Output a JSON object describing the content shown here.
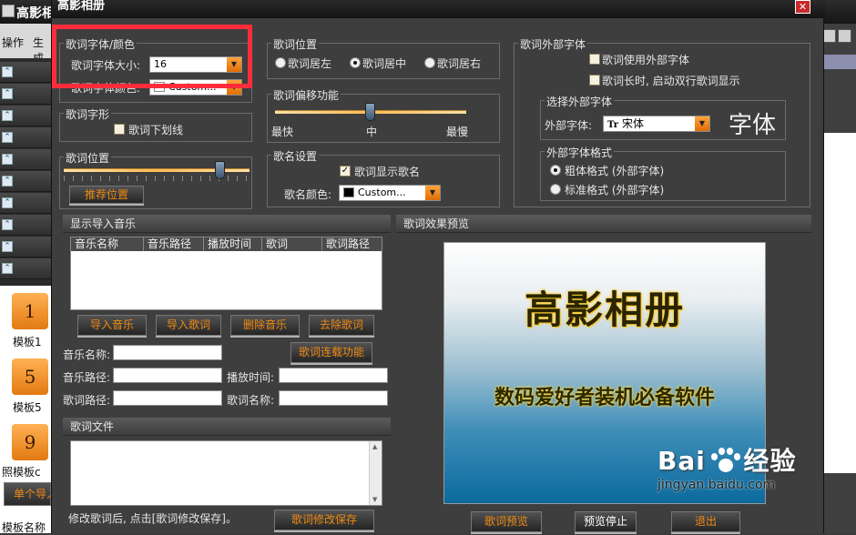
{
  "background_app": {
    "title": "高影相",
    "menu": [
      "操作",
      "生成"
    ],
    "templates": [
      {
        "num": "1",
        "label": "模板1"
      },
      {
        "num": "5",
        "label": "模板5"
      },
      {
        "num": "9",
        "label": "照模板c"
      }
    ],
    "single_button": "单个导入",
    "template_name_label": "模板名称"
  },
  "dialog": {
    "title": "高影相册",
    "lyric_font": {
      "group_title": "歌词字体/颜色",
      "size_label": "歌词字体大小:",
      "size_value": "16",
      "color_label": "歌词字体颜色:",
      "color_value": "Custom..."
    },
    "lyric_style": {
      "group_title": "歌词字形",
      "underline": "歌词下划线"
    },
    "lyric_pos_left": {
      "group_title": "歌词位置",
      "recommend_button": "推荐位置"
    },
    "lyric_pos": {
      "group_title": "歌词位置",
      "options": [
        "歌词居左",
        "歌词居中",
        "歌词居右"
      ],
      "selected": "歌词居中"
    },
    "offset": {
      "group_title": "歌词偏移功能",
      "labels": [
        "最快",
        "中",
        "最慢"
      ]
    },
    "song_name": {
      "group_title": "歌名设置",
      "show_checkbox": "歌词显示歌名",
      "color_label": "歌名颜色:",
      "color_value": "Custom..."
    },
    "external_font": {
      "group_title": "歌词外部字体",
      "use_external": "歌词使用外部字体",
      "double_line": "歌词长时, 启动双行歌词显示",
      "select_group": "选择外部字体",
      "font_label": "外部字体:",
      "font_value": "宋体",
      "font_sample": "字体",
      "format_group": "外部字体格式",
      "format_options": [
        "粗体格式 (外部字体)",
        "标准格式 (外部字体)"
      ],
      "format_selected": "粗体格式 (外部字体)"
    },
    "import_music": {
      "title": "显示导入音乐",
      "columns": [
        "音乐名称",
        "音乐路径",
        "播放时间",
        "歌词",
        "歌词路径"
      ],
      "buttons": [
        "导入音乐",
        "导入歌词",
        "删除音乐",
        "去除歌词"
      ],
      "music_name_label": "音乐名称:",
      "lyric_load_button": "歌词连载功能",
      "music_path_label": "音乐路径:",
      "play_time_label": "播放时间:",
      "lyric_path_label": "歌词路径:",
      "lyric_name_label": "歌词名称:"
    },
    "lyric_file": {
      "title": "歌词文件",
      "note": "修改歌词后, 点击[歌词修改保存]。",
      "save_button": "歌词修改保存"
    },
    "preview": {
      "title": "歌词效果预览",
      "main_text": "高影相册",
      "sub_text": "数码爱好者装机必备软件",
      "buttons": [
        "歌词预览",
        "预览停止",
        "退出"
      ]
    }
  },
  "watermark": {
    "logo_left": "Bai",
    "logo_right": "经验",
    "url": "jingyan.baidu.com"
  },
  "colors": {
    "accent_orange": "#f08a12",
    "highlight_red": "#ff2d3b",
    "dialog_bg": "#3e3e3e"
  }
}
